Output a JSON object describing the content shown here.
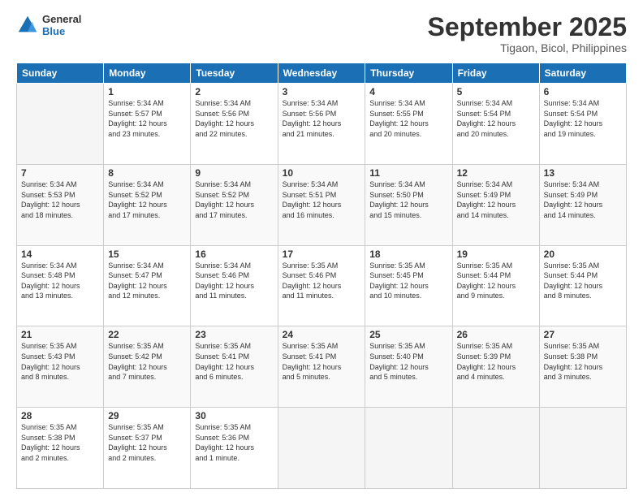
{
  "logo": {
    "general": "General",
    "blue": "Blue"
  },
  "header": {
    "month": "September 2025",
    "location": "Tigaon, Bicol, Philippines"
  },
  "weekdays": [
    "Sunday",
    "Monday",
    "Tuesday",
    "Wednesday",
    "Thursday",
    "Friday",
    "Saturday"
  ],
  "weeks": [
    [
      {
        "day": "",
        "info": ""
      },
      {
        "day": "1",
        "info": "Sunrise: 5:34 AM\nSunset: 5:57 PM\nDaylight: 12 hours\nand 23 minutes."
      },
      {
        "day": "2",
        "info": "Sunrise: 5:34 AM\nSunset: 5:56 PM\nDaylight: 12 hours\nand 22 minutes."
      },
      {
        "day": "3",
        "info": "Sunrise: 5:34 AM\nSunset: 5:56 PM\nDaylight: 12 hours\nand 21 minutes."
      },
      {
        "day": "4",
        "info": "Sunrise: 5:34 AM\nSunset: 5:55 PM\nDaylight: 12 hours\nand 20 minutes."
      },
      {
        "day": "5",
        "info": "Sunrise: 5:34 AM\nSunset: 5:54 PM\nDaylight: 12 hours\nand 20 minutes."
      },
      {
        "day": "6",
        "info": "Sunrise: 5:34 AM\nSunset: 5:54 PM\nDaylight: 12 hours\nand 19 minutes."
      }
    ],
    [
      {
        "day": "7",
        "info": "Sunrise: 5:34 AM\nSunset: 5:53 PM\nDaylight: 12 hours\nand 18 minutes."
      },
      {
        "day": "8",
        "info": "Sunrise: 5:34 AM\nSunset: 5:52 PM\nDaylight: 12 hours\nand 17 minutes."
      },
      {
        "day": "9",
        "info": "Sunrise: 5:34 AM\nSunset: 5:52 PM\nDaylight: 12 hours\nand 17 minutes."
      },
      {
        "day": "10",
        "info": "Sunrise: 5:34 AM\nSunset: 5:51 PM\nDaylight: 12 hours\nand 16 minutes."
      },
      {
        "day": "11",
        "info": "Sunrise: 5:34 AM\nSunset: 5:50 PM\nDaylight: 12 hours\nand 15 minutes."
      },
      {
        "day": "12",
        "info": "Sunrise: 5:34 AM\nSunset: 5:49 PM\nDaylight: 12 hours\nand 14 minutes."
      },
      {
        "day": "13",
        "info": "Sunrise: 5:34 AM\nSunset: 5:49 PM\nDaylight: 12 hours\nand 14 minutes."
      }
    ],
    [
      {
        "day": "14",
        "info": "Sunrise: 5:34 AM\nSunset: 5:48 PM\nDaylight: 12 hours\nand 13 minutes."
      },
      {
        "day": "15",
        "info": "Sunrise: 5:34 AM\nSunset: 5:47 PM\nDaylight: 12 hours\nand 12 minutes."
      },
      {
        "day": "16",
        "info": "Sunrise: 5:34 AM\nSunset: 5:46 PM\nDaylight: 12 hours\nand 11 minutes."
      },
      {
        "day": "17",
        "info": "Sunrise: 5:35 AM\nSunset: 5:46 PM\nDaylight: 12 hours\nand 11 minutes."
      },
      {
        "day": "18",
        "info": "Sunrise: 5:35 AM\nSunset: 5:45 PM\nDaylight: 12 hours\nand 10 minutes."
      },
      {
        "day": "19",
        "info": "Sunrise: 5:35 AM\nSunset: 5:44 PM\nDaylight: 12 hours\nand 9 minutes."
      },
      {
        "day": "20",
        "info": "Sunrise: 5:35 AM\nSunset: 5:44 PM\nDaylight: 12 hours\nand 8 minutes."
      }
    ],
    [
      {
        "day": "21",
        "info": "Sunrise: 5:35 AM\nSunset: 5:43 PM\nDaylight: 12 hours\nand 8 minutes."
      },
      {
        "day": "22",
        "info": "Sunrise: 5:35 AM\nSunset: 5:42 PM\nDaylight: 12 hours\nand 7 minutes."
      },
      {
        "day": "23",
        "info": "Sunrise: 5:35 AM\nSunset: 5:41 PM\nDaylight: 12 hours\nand 6 minutes."
      },
      {
        "day": "24",
        "info": "Sunrise: 5:35 AM\nSunset: 5:41 PM\nDaylight: 12 hours\nand 5 minutes."
      },
      {
        "day": "25",
        "info": "Sunrise: 5:35 AM\nSunset: 5:40 PM\nDaylight: 12 hours\nand 5 minutes."
      },
      {
        "day": "26",
        "info": "Sunrise: 5:35 AM\nSunset: 5:39 PM\nDaylight: 12 hours\nand 4 minutes."
      },
      {
        "day": "27",
        "info": "Sunrise: 5:35 AM\nSunset: 5:38 PM\nDaylight: 12 hours\nand 3 minutes."
      }
    ],
    [
      {
        "day": "28",
        "info": "Sunrise: 5:35 AM\nSunset: 5:38 PM\nDaylight: 12 hours\nand 2 minutes."
      },
      {
        "day": "29",
        "info": "Sunrise: 5:35 AM\nSunset: 5:37 PM\nDaylight: 12 hours\nand 2 minutes."
      },
      {
        "day": "30",
        "info": "Sunrise: 5:35 AM\nSunset: 5:36 PM\nDaylight: 12 hours\nand 1 minute."
      },
      {
        "day": "",
        "info": ""
      },
      {
        "day": "",
        "info": ""
      },
      {
        "day": "",
        "info": ""
      },
      {
        "day": "",
        "info": ""
      }
    ]
  ]
}
